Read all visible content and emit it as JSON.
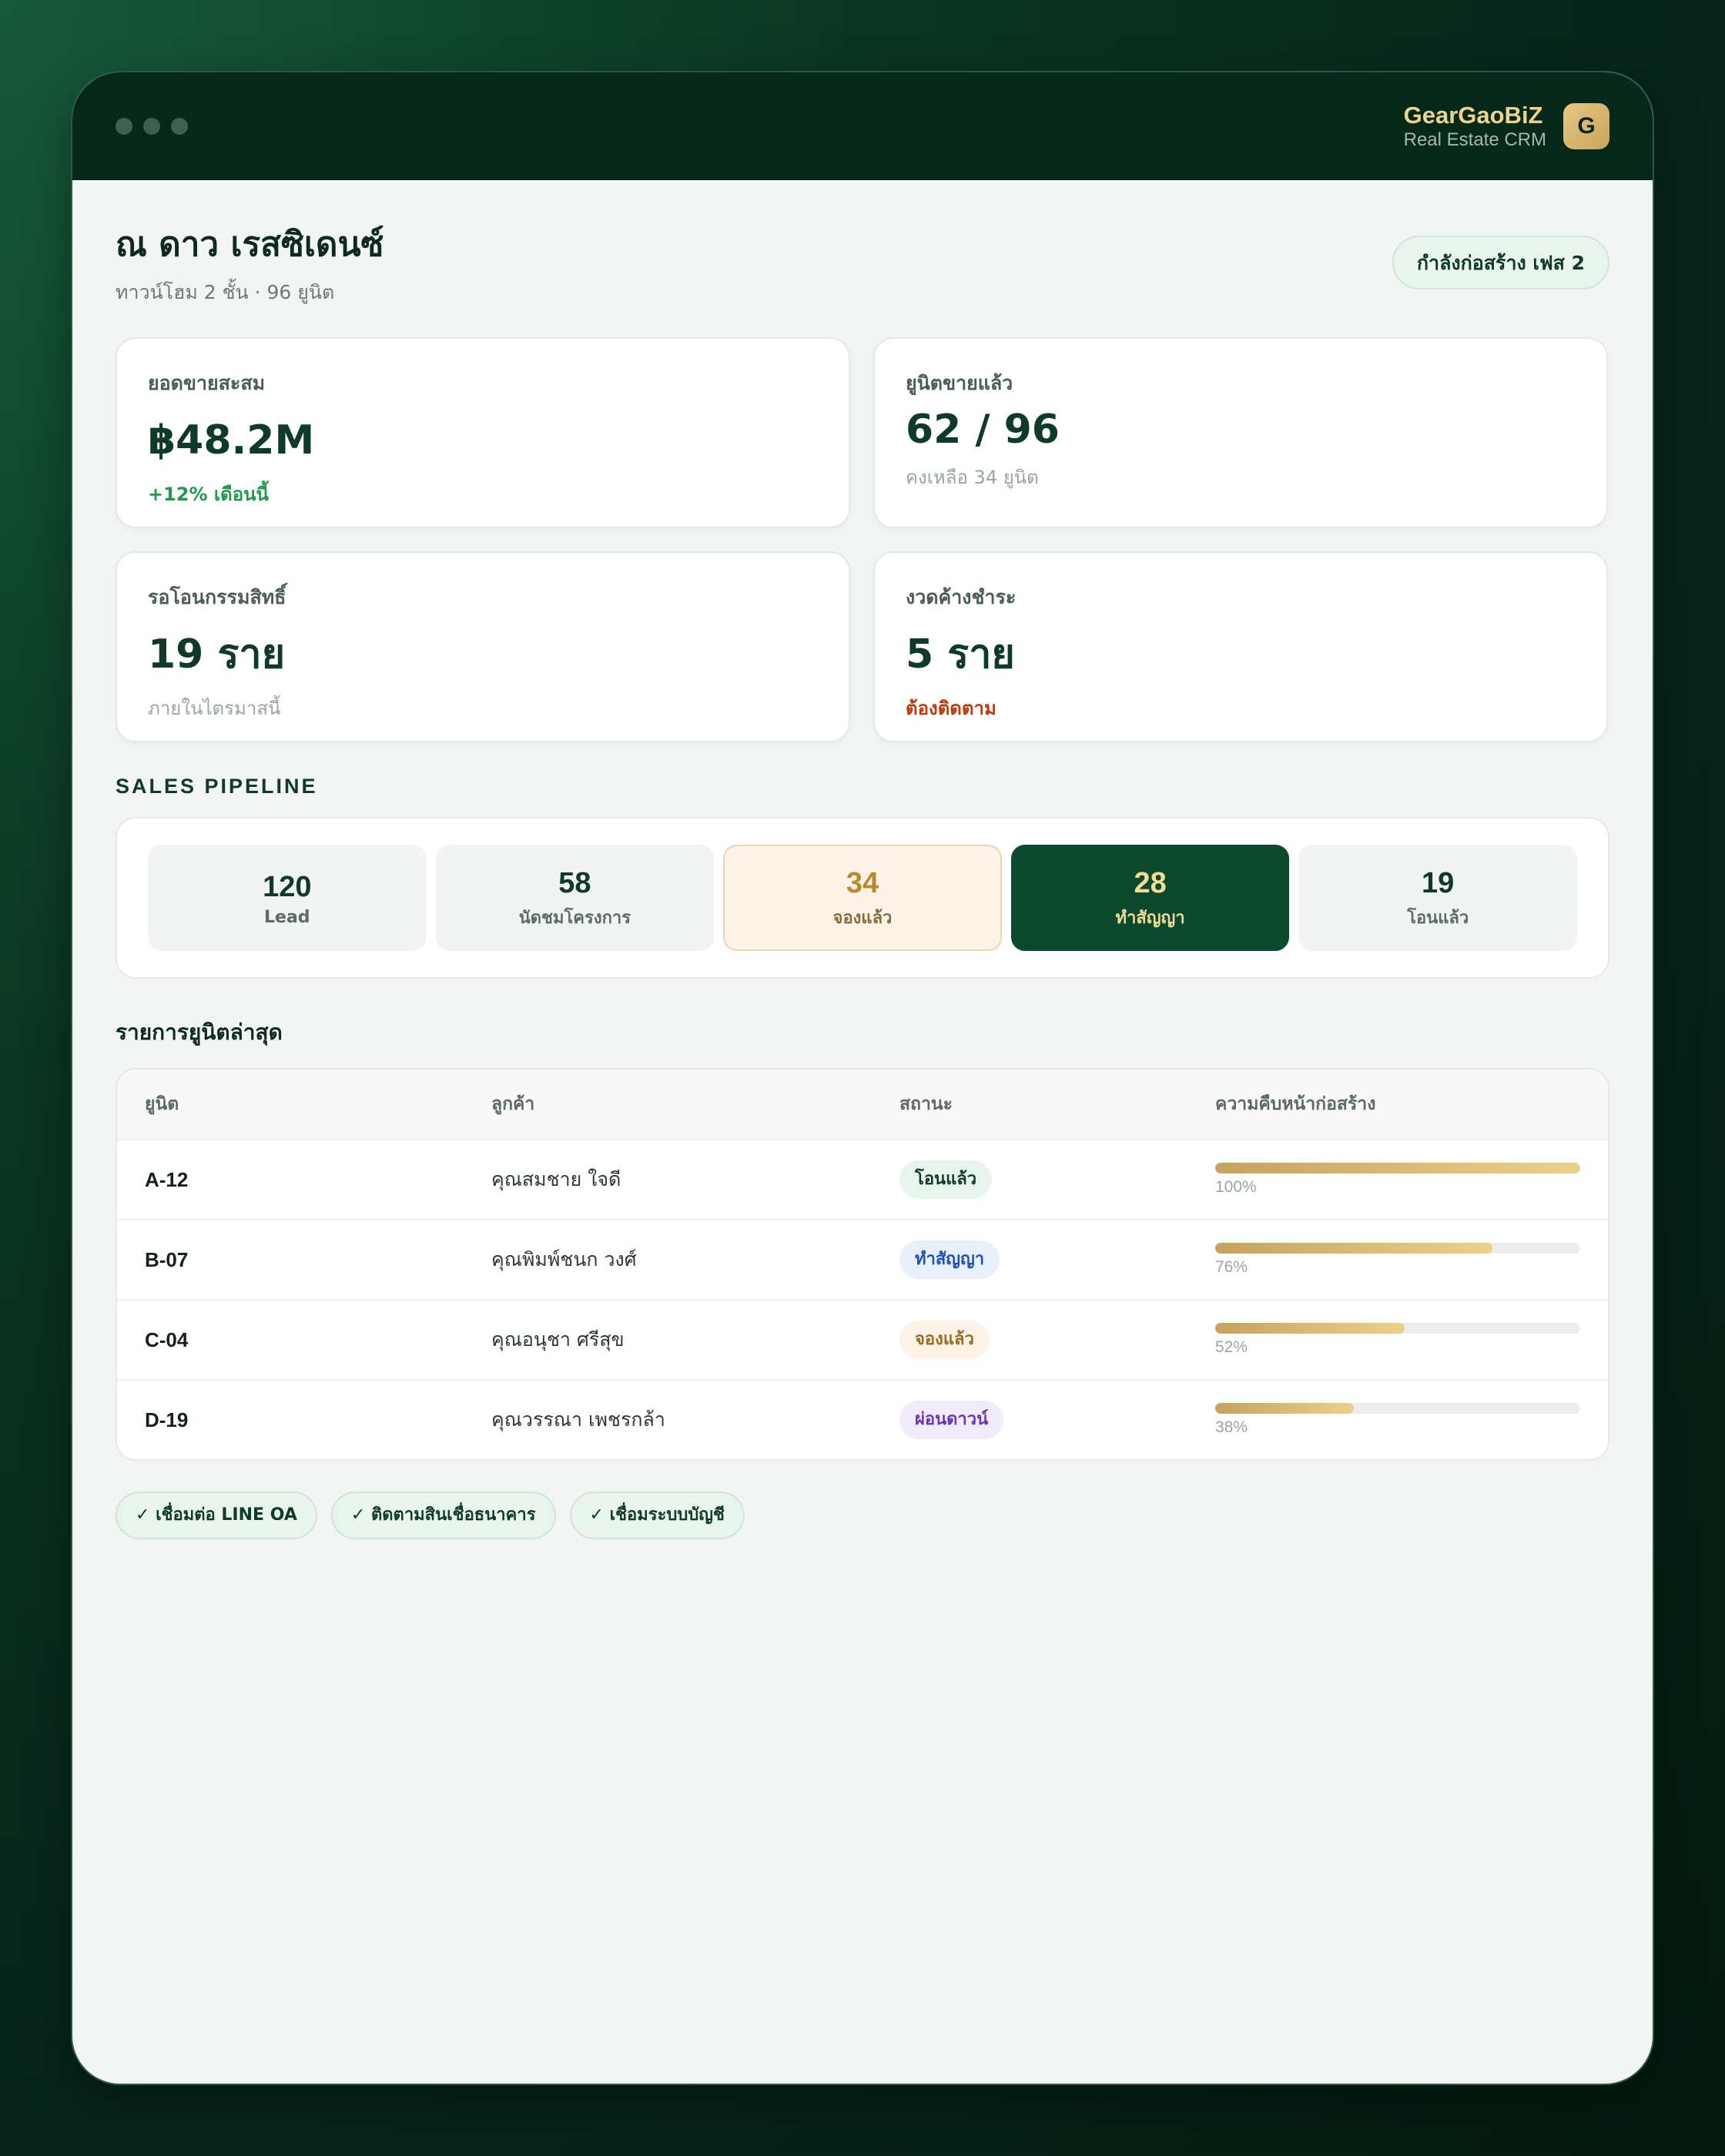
{
  "brand": {
    "name": "GearGaoBiZ",
    "subtitle": "Real Estate CRM",
    "logo_letter": "G"
  },
  "project": {
    "title": "ณ ดาว เรสซิเดนซ์",
    "subtitle": "ทาวน์โฮม 2 ชั้น · 96 ยูนิต",
    "phase_badge": "กำลังก่อสร้าง เฟส 2"
  },
  "kpis": [
    {
      "label": "ยอดขายสะสม",
      "value": "฿48.2M",
      "note": "+12% เดือนนี้",
      "note_tone": "green"
    },
    {
      "label": "ยูนิตขายแล้ว",
      "value": "62 / 96",
      "note": "คงเหลือ 34 ยูนิต",
      "note_tone": "muted"
    },
    {
      "label": "รอโอนกรรมสิทธิ์",
      "value": "19 ราย",
      "note": "ภายในไตรมาสนี้",
      "note_tone": "muted"
    },
    {
      "label": "งวดค้างชำระ",
      "value": "5 ราย",
      "note": "ต้องติดตาม",
      "note_tone": "red"
    }
  ],
  "pipeline": {
    "title": "SALES PIPELINE",
    "stages": [
      {
        "count": "120",
        "label": "Lead"
      },
      {
        "count": "58",
        "label": "นัดชมโครงการ"
      },
      {
        "count": "34",
        "label": "จองแล้ว"
      },
      {
        "count": "28",
        "label": "ทำสัญญา"
      },
      {
        "count": "19",
        "label": "โอนแล้ว"
      }
    ]
  },
  "units": {
    "title": "รายการยูนิตล่าสุด",
    "columns": [
      "ยูนิต",
      "ลูกค้า",
      "สถานะ",
      "ความคืบหน้าก่อสร้าง"
    ],
    "rows": [
      {
        "unit": "A-12",
        "customer": "คุณสมชาย ใจดี",
        "status": "โอนแล้ว",
        "progress": 100,
        "progress_label": "100%"
      },
      {
        "unit": "B-07",
        "customer": "คุณพิมพ์ชนก วงศ์",
        "status": "ทำสัญญา",
        "progress": 76,
        "progress_label": "76%"
      },
      {
        "unit": "C-04",
        "customer": "คุณอนุชา ศรีสุข",
        "status": "จองแล้ว",
        "progress": 52,
        "progress_label": "52%"
      },
      {
        "unit": "D-19",
        "customer": "คุณวรรณา เพชรกล้า",
        "status": "ผ่อนดาวน์",
        "progress": 38,
        "progress_label": "38%"
      }
    ]
  },
  "integrations": [
    "✓ เชื่อมต่อ LINE OA",
    "✓ ติดตามสินเชื่อธนาคาร",
    "✓ เชื่อมระบบบัญชี"
  ],
  "colors": {
    "primary": "#0c4a2e",
    "accent_gold": "#e6c784",
    "success": "#1f9a4a",
    "danger": "#c0390b"
  }
}
